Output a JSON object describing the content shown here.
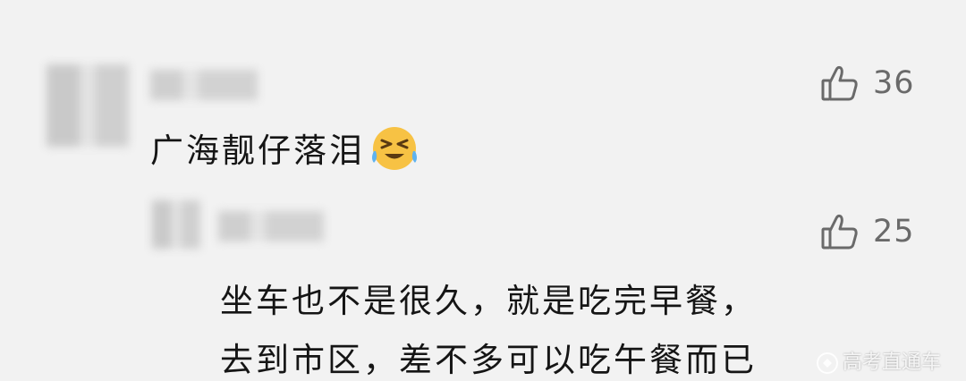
{
  "comments": [
    {
      "text": "广海靓仔落泪",
      "emoji": "crying-laughing-emoji",
      "likes": "36"
    },
    {
      "text_line1": "坐车也不是很久，就是吃完早餐，",
      "text_line2": "去到市区，差不多可以吃午餐而已",
      "likes": "25"
    }
  ],
  "watermark": "高考直通车",
  "icons": {
    "like": "thumbs-up-icon",
    "watermark_logo": "watermark-logo-icon"
  },
  "colors": {
    "background": "#f2f2f2",
    "text": "#151515",
    "like": "#6a6a6a",
    "emoji": "#f7c244"
  }
}
